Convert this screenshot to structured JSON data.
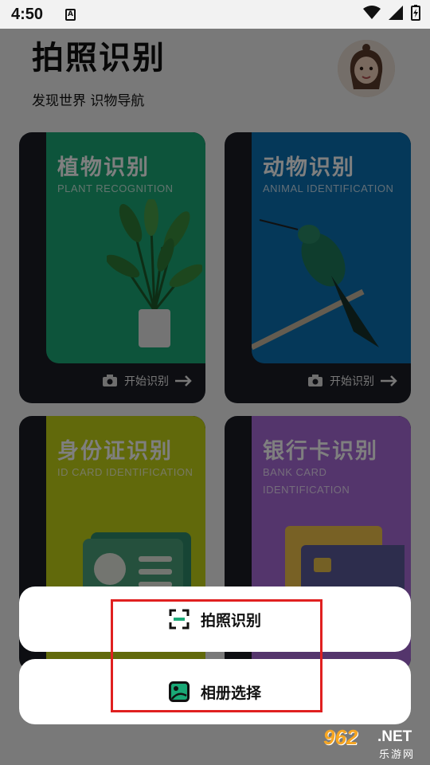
{
  "status_bar": {
    "time": "4:50",
    "a_icon": "A"
  },
  "header": {
    "title": "拍照识别",
    "subtitle": "发现世界 识物导航"
  },
  "cards": [
    {
      "title": "植物识别",
      "subtitle": "PLANT RECOGNITION",
      "action": "开始识别",
      "color": "#1aa876"
    },
    {
      "title": "动物识别",
      "subtitle": "ANIMAL IDENTIFICATION",
      "action": "开始识别",
      "color": "#0b71b3"
    },
    {
      "title": "身份证识别",
      "subtitle": "ID CARD IDENTIFICATION",
      "color": "#c2d217"
    },
    {
      "title": "银行卡识别",
      "subtitle": "BANK CARD IDENTIFICATION",
      "color": "#a96ad9"
    }
  ],
  "action_sheet": {
    "camera_label": "拍照识别",
    "album_label": "相册选择"
  },
  "watermark": {
    "number": "962",
    "domain": ".NET",
    "cn": "乐游网"
  },
  "colors": {
    "accent_green": "#1aa876",
    "highlight_red": "#e02020"
  }
}
